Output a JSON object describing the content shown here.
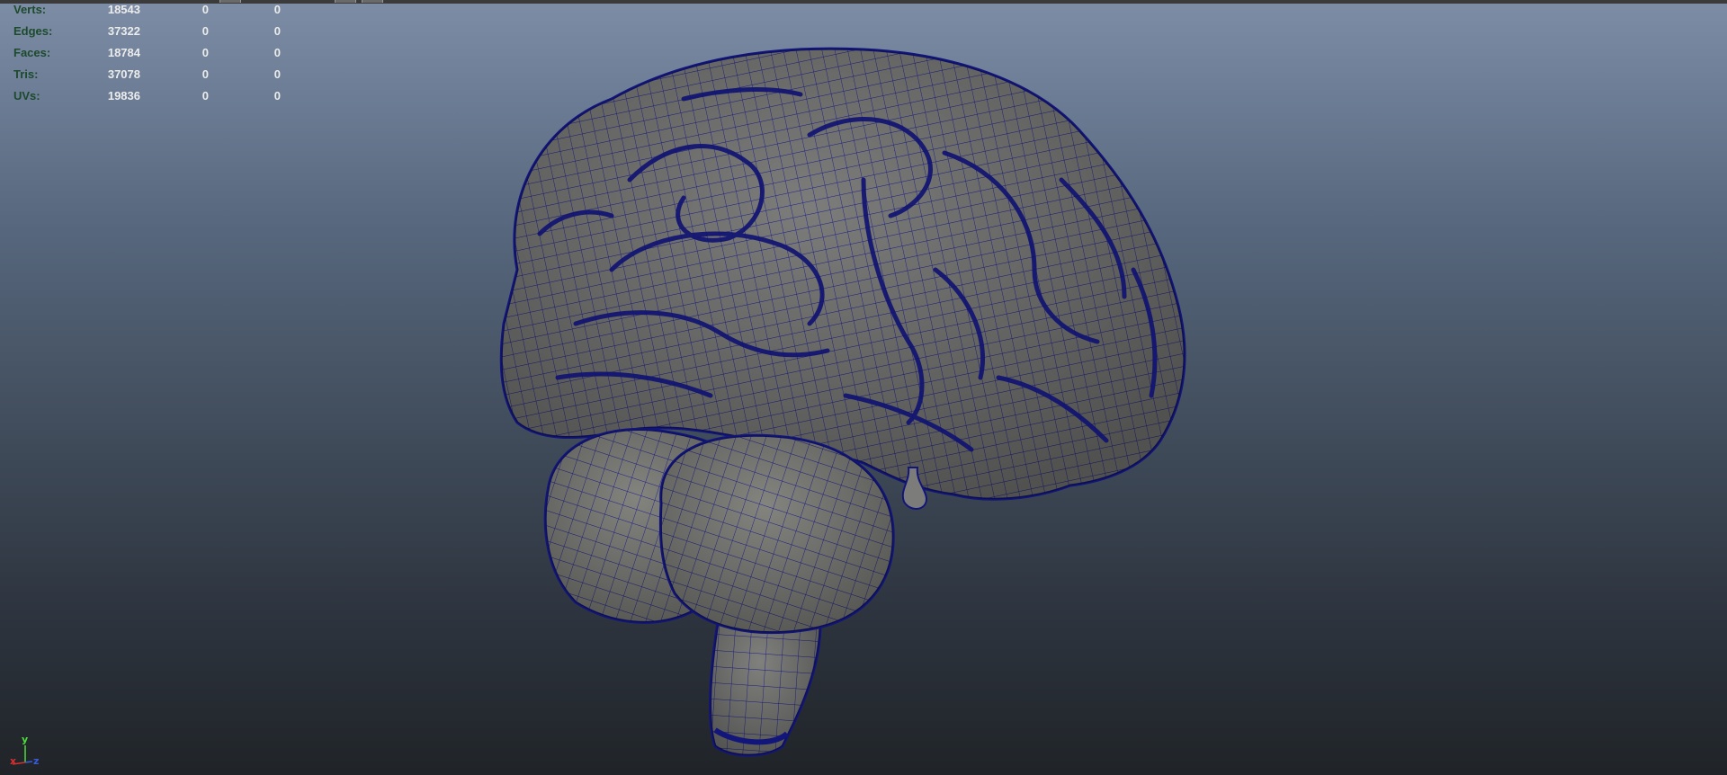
{
  "hud": {
    "rows": [
      {
        "label": "Verts:",
        "total": "18543",
        "col2": "0",
        "col3": "0"
      },
      {
        "label": "Edges:",
        "total": "37322",
        "col2": "0",
        "col3": "0"
      },
      {
        "label": "Faces:",
        "total": "18784",
        "col2": "0",
        "col3": "0"
      },
      {
        "label": "Tris:",
        "total": "37078",
        "col2": "0",
        "col3": "0"
      },
      {
        "label": "UVs:",
        "total": "19836",
        "col2": "0",
        "col3": "0"
      }
    ]
  },
  "axis": {
    "y": "y",
    "x": "x",
    "z": "z"
  },
  "colors": {
    "wireframe": "#161a8c",
    "surface": "#7a7a78",
    "hud_label": "#1c4a2d",
    "hud_value": "#ececec",
    "axis_x": "#d43030",
    "axis_y": "#4fdc3a",
    "axis_z": "#3a5bdc"
  }
}
